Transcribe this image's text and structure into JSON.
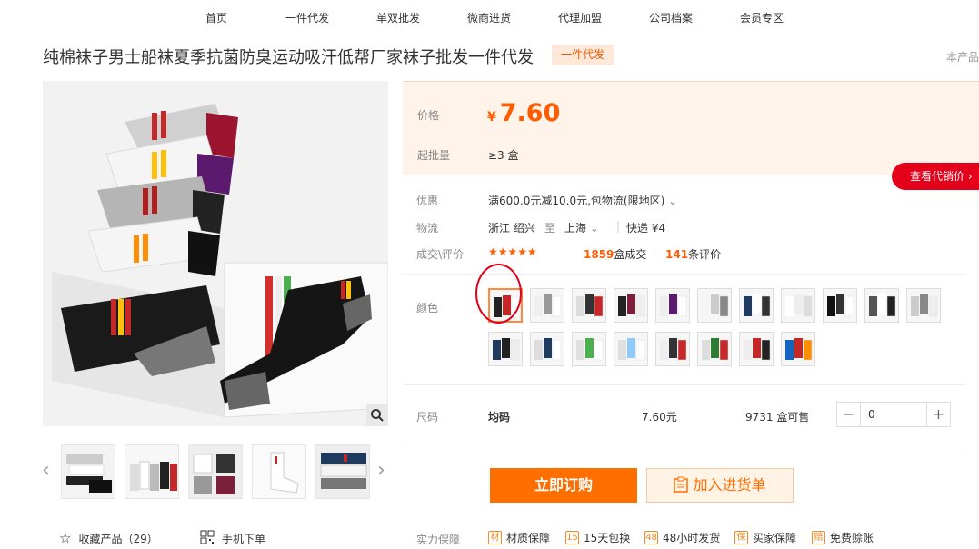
{
  "nav": [
    "首页",
    "一件代发",
    "单双批发",
    "微商进货",
    "代理加盟",
    "公司档案",
    "会员专区"
  ],
  "product": {
    "title": "纯棉袜子男士船袜夏季抗菌防臭运动吸汗低帮厂家袜子批发一件代发",
    "tag": "一件代发",
    "this_product": "本产品"
  },
  "price": {
    "label": "价格",
    "currency": "¥",
    "value": "7.60"
  },
  "moq": {
    "label": "起批量",
    "value": "≥3 盒"
  },
  "agent_price_button": "查看代销价",
  "promo": {
    "label": "优惠",
    "value": "满600.0元减10.0元,包物流(限地区)"
  },
  "logistics": {
    "label": "物流",
    "from": "浙江 绍兴",
    "to_word": "至",
    "to": "上海",
    "express": "快递 ¥4"
  },
  "deals": {
    "label": "成交\\评价",
    "rating": 4.5,
    "stars": "★★★★★",
    "count": "1859",
    "count_unit": "盒成交",
    "reviews": "141",
    "reviews_unit": "条评价"
  },
  "color": {
    "label": "颜色",
    "swatch_count": 19,
    "selected_index": 0
  },
  "size": {
    "label": "尺码",
    "name": "均码",
    "price": "7.60元",
    "stock": "9731 盒可售",
    "quantity": "0",
    "minus": "−",
    "plus": "+"
  },
  "buy_now": "立即订购",
  "add_to_list": "加入进货单",
  "left_links": {
    "favorite": "收藏产品（29）",
    "mobile": "手机下单"
  },
  "guarantee": {
    "label": "实力保障",
    "items": [
      {
        "icon": "材",
        "text": "材质保障"
      },
      {
        "icon": "15",
        "text": "15天包换"
      },
      {
        "icon": "48",
        "text": "48小时发货"
      },
      {
        "icon": "保",
        "text": "买家保障"
      },
      {
        "icon": "赔",
        "text": "免费赊账"
      }
    ]
  },
  "colors": {
    "accent": "#ff5c00",
    "agent_red": "#e4001a",
    "price_bg": "#fff3ea"
  }
}
